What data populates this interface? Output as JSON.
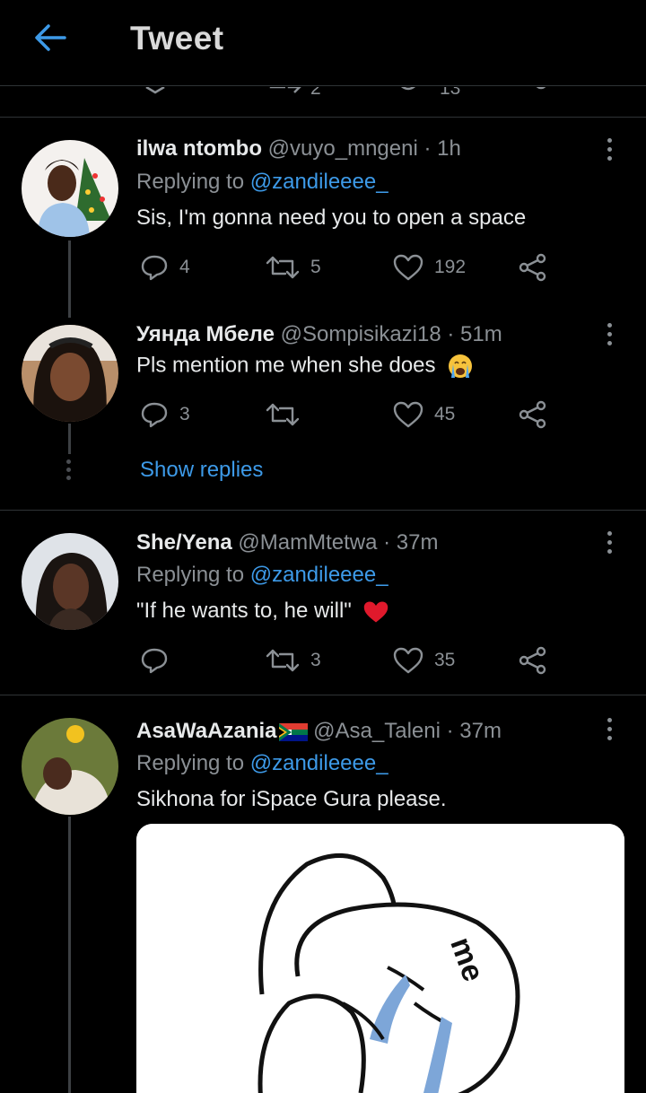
{
  "header": {
    "title": "Tweet",
    "back_icon": "arrow-left-icon"
  },
  "prev_actions": {
    "retweets": "2",
    "likes": "13"
  },
  "tweets": [
    {
      "name": "ilwa ntombo",
      "handle": "@vuyo_mngeni",
      "time": "· 1h",
      "replying_label": "Replying to",
      "replying_handle": "@zandileeee_",
      "text": "Sis, I'm gonna need you to open a space",
      "replies": "4",
      "retweets": "5",
      "likes": "192"
    },
    {
      "name": "Уянда Мбеле",
      "handle": "@Sompisikazi18",
      "time": "· 51m",
      "text": "Pls mention me when she does",
      "emoji": "crying-face-icon",
      "replies": "3",
      "retweets": "",
      "likes": "45",
      "show_replies": "Show replies"
    },
    {
      "name": "She/Yena",
      "handle": "@MamMtetwa",
      "time": "· 37m",
      "replying_label": "Replying to",
      "replying_handle": "@zandileeee_",
      "text": "\"If he wants to, he will\"",
      "emoji": "red-heart-icon",
      "replies": "",
      "retweets": "3",
      "likes": "35"
    },
    {
      "name": "AsaWaAzania",
      "flag": "south-africa-flag-icon",
      "handle": "@Asa_Taleni",
      "time": "· 37m",
      "replying_label": "Replying to",
      "replying_handle": "@zandileeee_",
      "text": "Sikhona for iSpace Gura please.",
      "media_text": "me"
    }
  ],
  "colors": {
    "background": "#000000",
    "accent": "#3d9ae8",
    "secondary_text": "#8b9095",
    "divider": "#2f3336",
    "heart": "#e0245e"
  }
}
